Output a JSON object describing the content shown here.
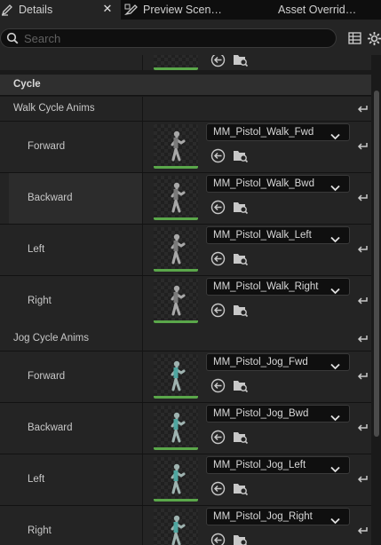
{
  "tabs": [
    {
      "label": "Details",
      "icon": "pencil-icon",
      "active": true
    },
    {
      "label": "Preview Scen…",
      "icon": "preview-scene-icon",
      "active": false
    },
    {
      "label": "Asset Overrid…",
      "icon": "",
      "active": false
    }
  ],
  "search": {
    "placeholder": "Search"
  },
  "category": {
    "label": "Cycle"
  },
  "groups": {
    "walk": {
      "label": "Walk Cycle Anims"
    },
    "jog": {
      "label": "Jog Cycle Anims"
    }
  },
  "walk_items": [
    {
      "label": "Forward",
      "asset": "MM_Pistol_Walk_Fwd"
    },
    {
      "label": "Backward",
      "asset": "MM_Pistol_Walk_Bwd"
    },
    {
      "label": "Left",
      "asset": "MM_Pistol_Walk_Left"
    },
    {
      "label": "Right",
      "asset": "MM_Pistol_Walk_Right"
    }
  ],
  "jog_items": [
    {
      "label": "Forward",
      "asset": "MM_Pistol_Jog_Fwd"
    },
    {
      "label": "Backward",
      "asset": "MM_Pistol_Jog_Bwd"
    },
    {
      "label": "Left",
      "asset": "MM_Pistol_Jog_Left"
    },
    {
      "label": "Right",
      "asset": "MM_Pistol_Jog_Right"
    }
  ],
  "colors": {
    "accent_green": "#5aa74a",
    "panel": "#242424",
    "category": "#2f2f2f"
  }
}
